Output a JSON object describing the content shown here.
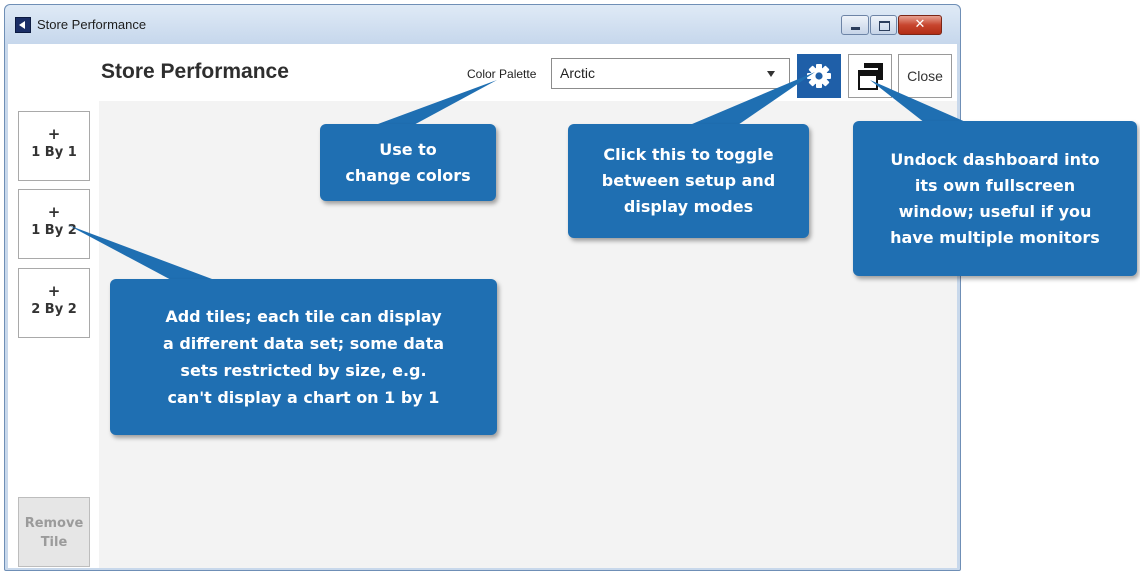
{
  "window": {
    "title": "Store Performance",
    "close_glyph": "✕"
  },
  "header": {
    "title": "Store Performance",
    "palette_label": "Color Palette",
    "palette_value": "Arctic",
    "close_label": "Close",
    "accent_color": "#1f5fa8"
  },
  "icons": {
    "gear": "gear-icon",
    "undock": "undock-window-icon",
    "dropdown": "chevron-down-icon"
  },
  "sidebar": {
    "tiles": [
      {
        "plus": "+",
        "label": "1 By 1"
      },
      {
        "plus": "+",
        "label": "1 By 2"
      },
      {
        "plus": "+",
        "label": "2 By 2"
      }
    ],
    "remove_label": "Remove\nTile"
  },
  "callouts": {
    "colors": "Use to\nchange colors",
    "toggle": "Click this to toggle\nbetween setup and\ndisplay modes",
    "undock": "Undock dashboard into\nits own fullscreen\nwindow; useful if you\nhave multiple monitors",
    "tiles": "Add tiles; each tile can display\na different data set; some data\nsets restricted by size, e.g.\ncan't display a chart on 1 by 1",
    "color": "#1f6fb2"
  }
}
